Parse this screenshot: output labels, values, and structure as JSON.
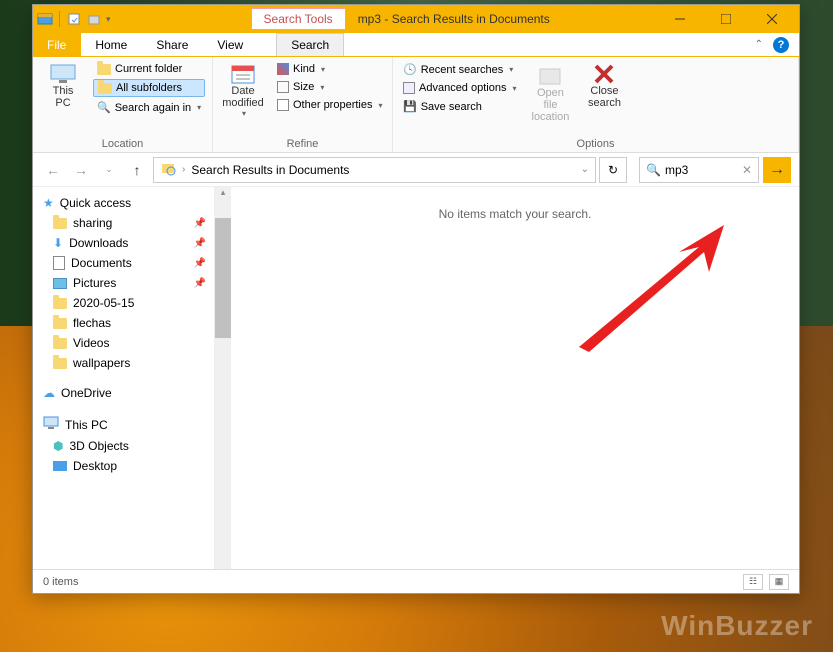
{
  "window": {
    "search_tools_label": "Search Tools",
    "title": "mp3 - Search Results in Documents"
  },
  "tabs": {
    "file": "File",
    "home": "Home",
    "share": "Share",
    "view": "View",
    "search": "Search"
  },
  "ribbon": {
    "location": {
      "this_pc": "This\nPC",
      "current_folder": "Current folder",
      "all_subfolders": "All subfolders",
      "search_again": "Search again in",
      "label": "Location"
    },
    "refine": {
      "date_modified": "Date\nmodified",
      "kind": "Kind",
      "size": "Size",
      "other_properties": "Other properties",
      "label": "Refine"
    },
    "options": {
      "recent_searches": "Recent searches",
      "advanced_options": "Advanced options",
      "save_search": "Save search",
      "open_file_location": "Open file\nlocation",
      "close_search": "Close\nsearch",
      "label": "Options"
    }
  },
  "nav": {
    "breadcrumb": "Search Results in Documents",
    "search_value": "mp3"
  },
  "sidebar": {
    "quick_access": "Quick access",
    "items": [
      {
        "label": "sharing",
        "icon": "folder",
        "pinned": true
      },
      {
        "label": "Downloads",
        "icon": "download",
        "pinned": true
      },
      {
        "label": "Documents",
        "icon": "document",
        "pinned": true
      },
      {
        "label": "Pictures",
        "icon": "picture",
        "pinned": true
      },
      {
        "label": "2020-05-15",
        "icon": "folder",
        "pinned": false
      },
      {
        "label": "flechas",
        "icon": "folder",
        "pinned": false
      },
      {
        "label": "Videos",
        "icon": "folder",
        "pinned": false
      },
      {
        "label": "wallpapers",
        "icon": "folder",
        "pinned": false
      }
    ],
    "onedrive": "OneDrive",
    "this_pc": "This PC",
    "pc_items": [
      {
        "label": "3D Objects",
        "icon": "3d"
      },
      {
        "label": "Desktop",
        "icon": "desktop"
      }
    ]
  },
  "content": {
    "empty": "No items match your search."
  },
  "status": {
    "items": "0 items"
  },
  "watermark": "WinBuzzer"
}
